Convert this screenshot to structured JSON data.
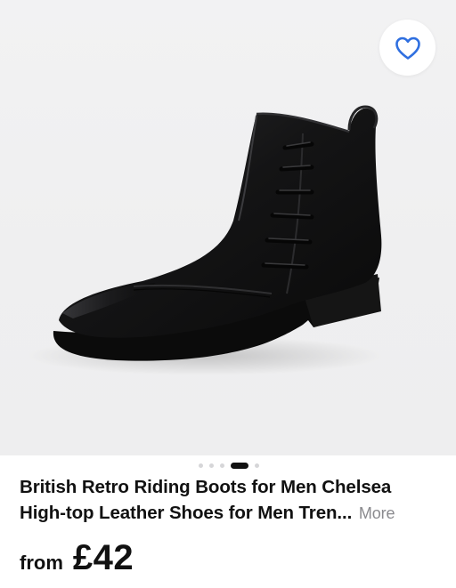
{
  "gallery": {
    "image_alt": "Black leather ankle boot with side laces",
    "favorite_icon": "heart-outline-icon",
    "accent_color": "#2f6fe0",
    "slide_count": 5,
    "active_slide": 4
  },
  "product": {
    "title_line1": "British Retro Riding Boots for Men Chelsea",
    "title_line2": "High-top Leather Shoes for Men Tren...",
    "more_label": "More"
  },
  "price": {
    "prefix": "from",
    "value": "£42"
  }
}
